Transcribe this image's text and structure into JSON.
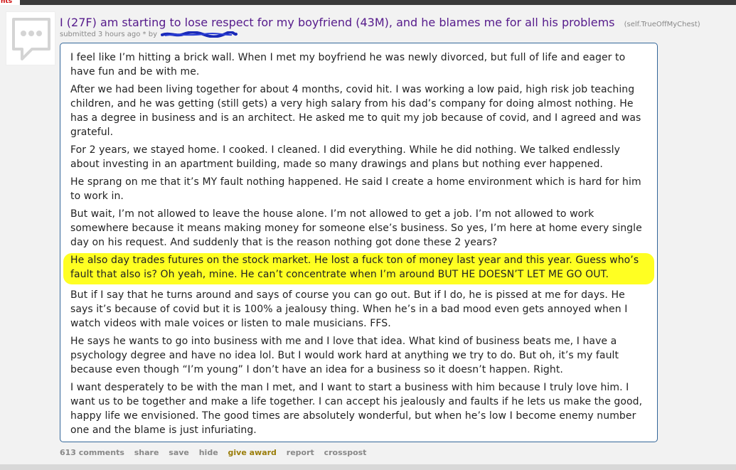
{
  "header": {
    "tab_label": "nts"
  },
  "post": {
    "title": "I (27F) am starting to lose respect for my boyfriend (43M), and he blames me for all his problems",
    "domain": "(self.TrueOffMyChest)",
    "tagline": "submitted 3 hours ago * by",
    "thumbnail_icon": "speech-bubble-icon",
    "paragraphs": [
      "I feel like I’m hitting a brick wall. When I met my boyfriend he was newly divorced, but full of life and eager to have fun and be with me.",
      "After we had been living together for about 4 months, covid hit. I was working a low paid, high risk job teaching children, and he was getting (still gets) a very high salary from his dad’s company for doing almost nothing. He has a degree in business and is an architect. He asked me to quit my job because of covid, and I agreed and was grateful.",
      "For 2 years, we stayed home. I cooked. I cleaned. I did everything. While he did nothing. We talked endlessly about investing in an apartment building, made so many drawings and plans but nothing ever happened.",
      "He sprang on me that it’s MY fault nothing happened. He said I create a home environment which is hard for him to work in.",
      "But wait, I’m not allowed to leave the house alone. I’m not allowed to get a job. I’m not allowed to work somewhere because it means making money for someone else’s business. So yes, I’m here at home every single day on his request. And suddenly that is the reason nothing got done these 2 years?",
      "He also day trades futures on the stock market. He lost a fuck ton of money last year and this year. Guess who’s fault that also is? Oh yeah, mine. He can’t concentrate when I’m around BUT HE DOESN’T LET ME GO OUT.",
      "But if I say that he turns around and says of course you can go out. But if I do, he is pissed at me for days. He says it’s because of covid but it is 100% a jealousy thing. When he’s in a bad mood even gets annoyed when I watch videos with male voices or listen to male musicians. FFS.",
      "He says he wants to go into business with me and I love that idea. What kind of business beats me, I have a psychology degree and have no idea lol. But I would work hard at anything we try to do. But oh, it’s my fault because even though “I’m young” I don’t have an idea for a business so it doesn’t happen. Right.",
      "I want desperately to be with the man I met, and I want to start a business with him because I truly love him. I want us to be together and make a life together. I can accept his jealously and faults if he lets us make the good, happy life we envisioned. The good times are absolutely wonderful, but when he’s low I become enemy number one and the blame is just infuriating."
    ],
    "highlight_color": "#ffff22"
  },
  "actions": {
    "comments": "613 comments",
    "share": "share",
    "save": "save",
    "hide": "hide",
    "give_award": "give award",
    "report": "report",
    "crosspost": "crosspost"
  }
}
